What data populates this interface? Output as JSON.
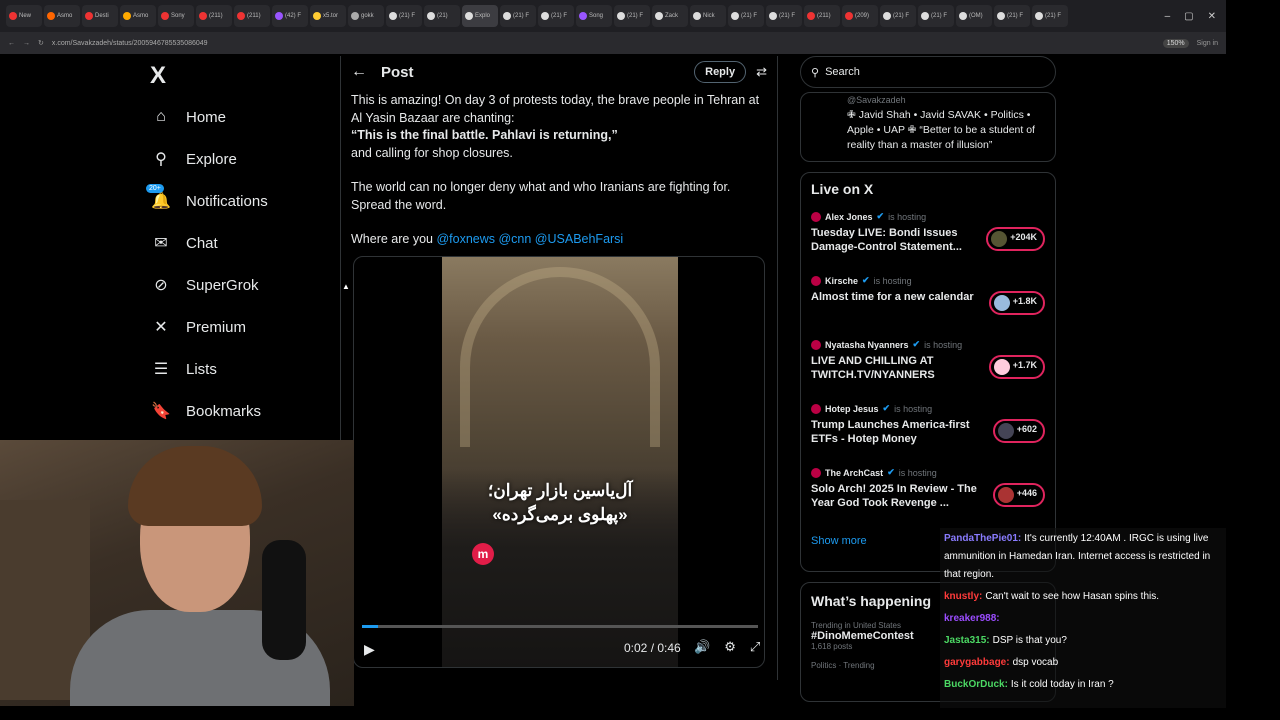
{
  "browser": {
    "tabs": [
      "New",
      "Asmo",
      "Desti",
      "Asmo",
      "Sony",
      "(211)",
      "(211)",
      "(42) F",
      "x5.tor",
      "gokk",
      "(21) F",
      "(21)",
      "Explo",
      "(21) F",
      "(21) F",
      "Song",
      "(21) F",
      "Zack",
      "Nick",
      "(21) F",
      "(21) F",
      "(211)",
      "(209)",
      "(21) F",
      "(21) F",
      "(OM)",
      "(21) F",
      "(21) F"
    ],
    "url": "x.com/Savakzadeh/status/2005946785535086049",
    "zoom": "150%",
    "sign_in": "Sign in"
  },
  "nav": {
    "logo": "X",
    "items": [
      {
        "label": "Home"
      },
      {
        "label": "Explore"
      },
      {
        "label": "Notifications",
        "badge": "20+"
      },
      {
        "label": "Chat"
      },
      {
        "label": "SuperGrok"
      },
      {
        "label": "Premium"
      },
      {
        "label": "Lists"
      },
      {
        "label": "Bookmarks"
      }
    ]
  },
  "post": {
    "header_title": "Post",
    "reply_label": "Reply",
    "line1": "This is amazing! On day 3 of protests today, the brave people in Tehran at Al Yasin Bazaar are chanting:",
    "quote": "“This is the final battle. Pahlavi is returning,”",
    "line2": "and calling for shop closures.",
    "para2": "The world can no longer deny what and who Iranians are fighting for. Spread the word.",
    "where": "Where are you",
    "mentions": "@foxnews @cnn @USABehFarsi",
    "video": {
      "caption_line1": "آل‌یاسین بازار تهران؛",
      "caption_line2": "«پهلوی برمی‌گرده»",
      "logo": "m",
      "time": "0:02 / 0:46",
      "progress": 0.04
    }
  },
  "sidebar": {
    "search_placeholder": "Search",
    "profile_handle": "@Savakzadeh",
    "profile_bio": "✙ Javid Shah • Javid SAVAK • Politics • Apple • UAP ✙ “Better to be a student of reality than a master of illusion”",
    "live_title": "Live on X",
    "hosting": "is hosting",
    "live": [
      {
        "host": "Alex Jones",
        "title": "Tuesday LIVE: Bondi Issues Damage-Control Statement...",
        "count": "+204K"
      },
      {
        "host": "Kirsche",
        "title": "Almost time for a new calendar",
        "count": "+1.8K"
      },
      {
        "host": "Nyatasha Nyanners",
        "title": "LIVE AND CHILLING AT TWITCH.TV/NYANNERS",
        "count": "+1.7K"
      },
      {
        "host": "Hotep Jesus",
        "title": "Trump Launches America-first ETFs - Hotep Money",
        "count": "+602"
      },
      {
        "host": "The ArchCast",
        "title": "Solo Arch! 2025 In Review - The Year God Took Revenge ...",
        "count": "+446"
      }
    ],
    "show_more": "Show more",
    "happening_title": "What’s happening",
    "trend_context": "Trending in United States",
    "trend_name": "#DinoMemeContest",
    "trend_posts": "1,618 posts",
    "trend2_context": "Politics · Trending"
  },
  "chat": [
    {
      "user": "PandaThePie01:",
      "color": "#8a7cff",
      "text": "It's currently 12:40AM . IRGC is using live ammunition in Hamedan Iran. Internet access is restricted in that region."
    },
    {
      "user": "knustly:",
      "color": "#ff3b3b",
      "text": "Can't wait to see how Hasan spins this."
    },
    {
      "user": "kreaker988:",
      "color": "#9b4dff",
      "text": ""
    },
    {
      "user": "Jasta315:",
      "color": "#4cd964",
      "text": "DSP is that you?"
    },
    {
      "user": "garygabbage:",
      "color": "#ff3b3b",
      "text": "dsp vocab"
    },
    {
      "user": "BuckOrDuck:",
      "color": "#4cd964",
      "text": "Is it cold today in Iran ?"
    }
  ]
}
